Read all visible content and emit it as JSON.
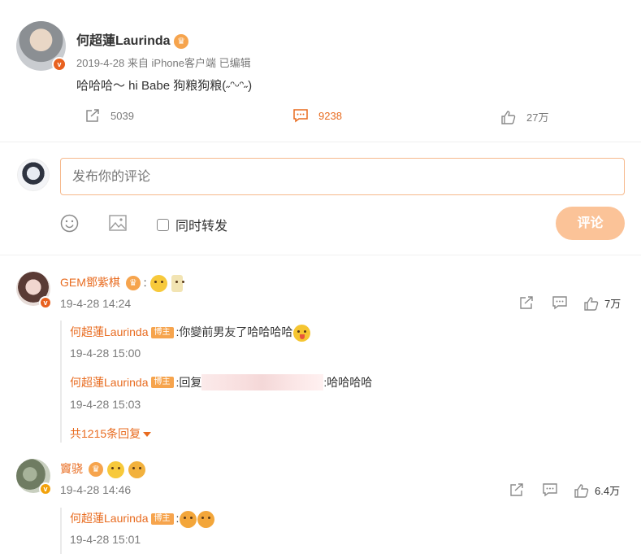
{
  "post": {
    "author": "何超蓮Laurinda",
    "date": "2019-4-28",
    "source": "来自 iPhone客户端",
    "edited": "已编辑",
    "text": "哈哈哈～ hi Babe 狗粮狗粮(˶ᵔᵕᵔ˶)",
    "repost_count": "5039",
    "comment_count": "9238",
    "like_count": "27万"
  },
  "composer": {
    "placeholder": "发布你的评论",
    "repost_label": "同时转发",
    "submit_label": "评论"
  },
  "comments": [
    {
      "author": "GEM鄧紫棋",
      "extra": ":",
      "time": "19-4-28 14:24",
      "like_count": "7万",
      "replies": [
        {
          "author": "何超蓮Laurinda",
          "tag": "博主",
          "text": ":你變前男友了哈哈哈哈",
          "time": "19-4-28 15:00"
        },
        {
          "author": "何超蓮Laurinda",
          "tag": "博主",
          "text_prefix": ":回复",
          "text_suffix": ":哈哈哈哈",
          "time": "19-4-28 15:03"
        }
      ],
      "more_replies": "共1215条回复"
    },
    {
      "author": "竇骁",
      "time": "19-4-28 14:46",
      "like_count": "6.4万",
      "replies": [
        {
          "author": "何超蓮Laurinda",
          "tag": "博主",
          "text": ":",
          "time": "19-4-28 15:01"
        }
      ]
    }
  ],
  "colors": {
    "accent": "#e86b1f",
    "submit_bg": "#fbc398",
    "input_border": "#f6b98c"
  }
}
